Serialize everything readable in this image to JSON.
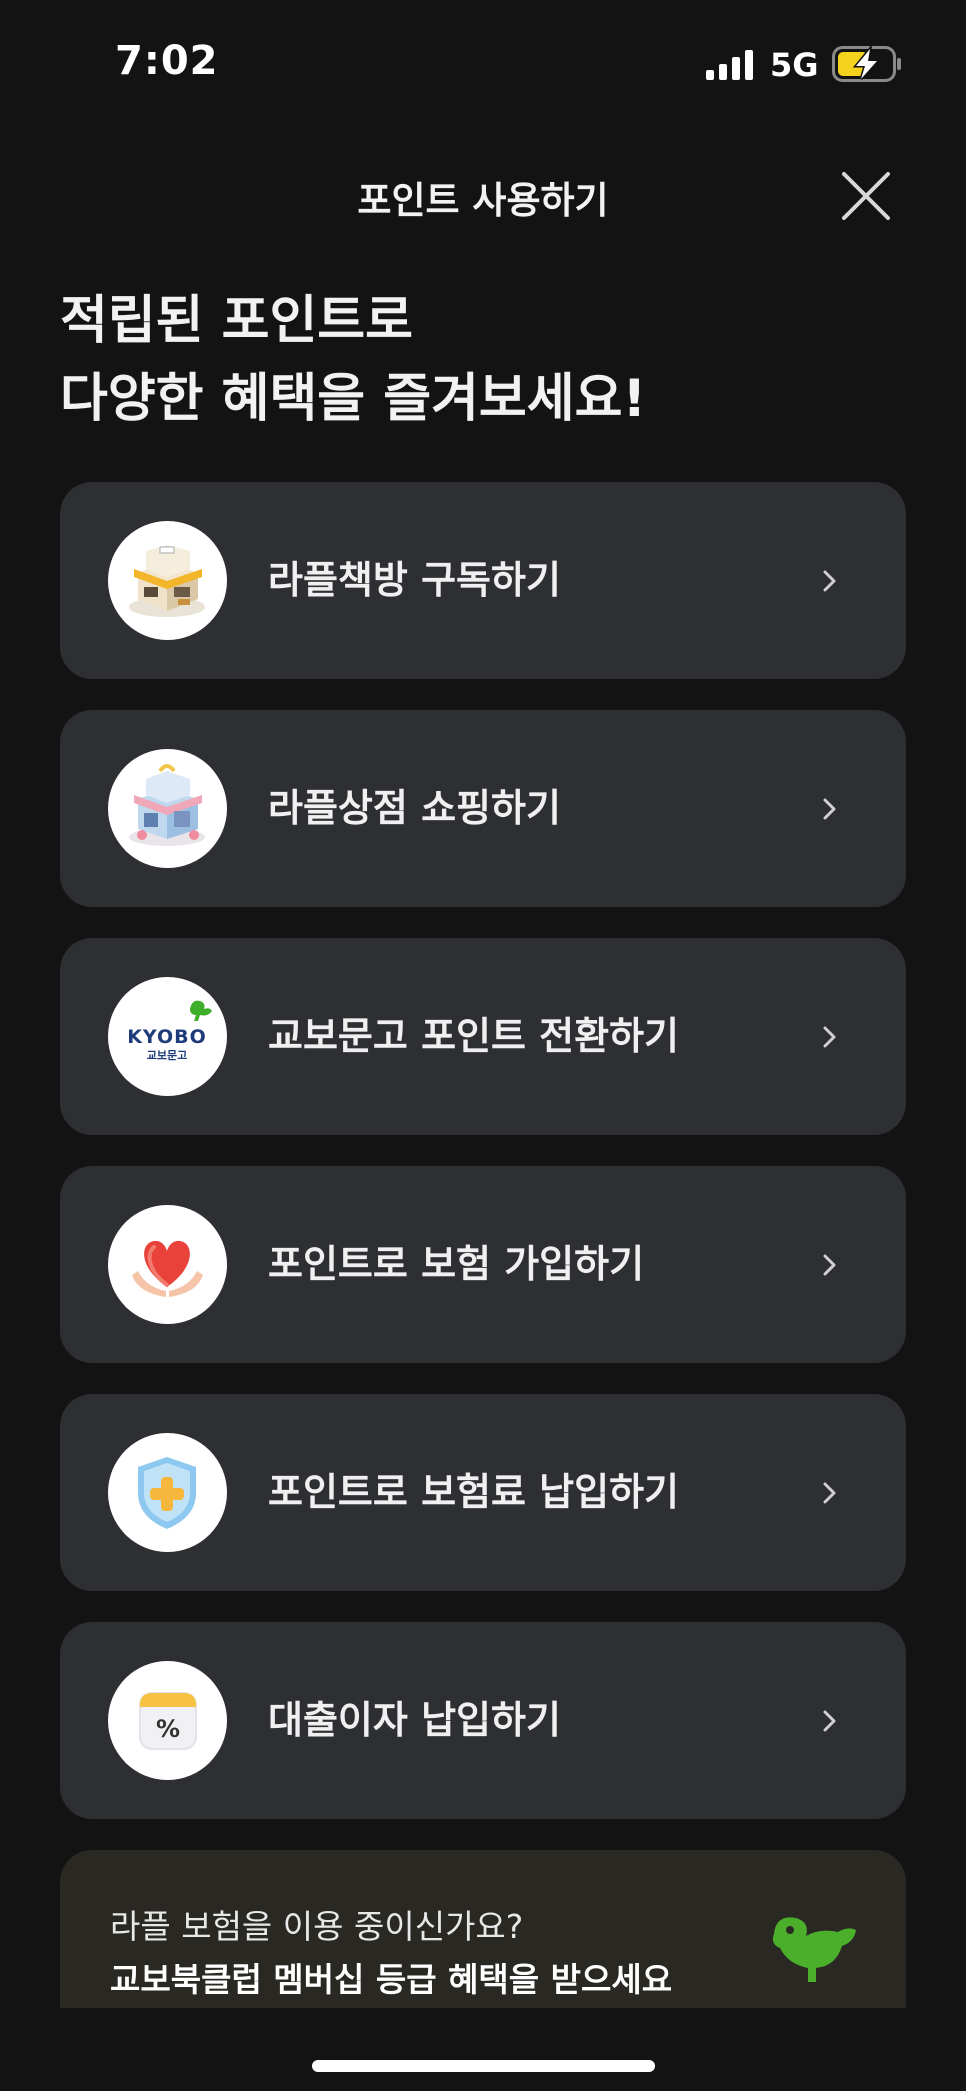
{
  "status_bar": {
    "time": "7:02",
    "network": "5G",
    "icons": [
      "signal-icon",
      "battery-charging-icon"
    ],
    "battery_color": "#f5d21e"
  },
  "header": {
    "title": "포인트 사용하기",
    "close_icon": "close-icon"
  },
  "headline": {
    "line1": "적립된 포인트로",
    "line2": "다양한 혜택을 즐겨보세요!"
  },
  "menu": {
    "items": [
      {
        "label": "라플책방 구독하기",
        "icon": "bookstore-icon"
      },
      {
        "label": "라플상점 쇼핑하기",
        "icon": "shop-icon"
      },
      {
        "label": "교보문고 포인트 전환하기",
        "icon": "kyobo-logo-icon",
        "logo_text": "KYOBO",
        "logo_subtext": "교보문고"
      },
      {
        "label": "포인트로 보험 가입하기",
        "icon": "heart-hands-icon"
      },
      {
        "label": "포인트로 보험료 납입하기",
        "icon": "shield-plus-icon"
      },
      {
        "label": "대출이자 납입하기",
        "icon": "percent-calendar-icon",
        "icon_text": "%"
      }
    ],
    "chevron_icon": "chevron-right-icon"
  },
  "banner": {
    "line1": "라플 보험을 이용 중이신가요?",
    "line2": "교보북클럽 멤버십 등급 혜택을 받으세요",
    "icon": "kyobo-bird-icon",
    "accent": "#4caf2b"
  },
  "colors": {
    "background": "#131313",
    "card": "#2e2f33",
    "banner": "#2a2823",
    "text": "#f2f2f2"
  }
}
